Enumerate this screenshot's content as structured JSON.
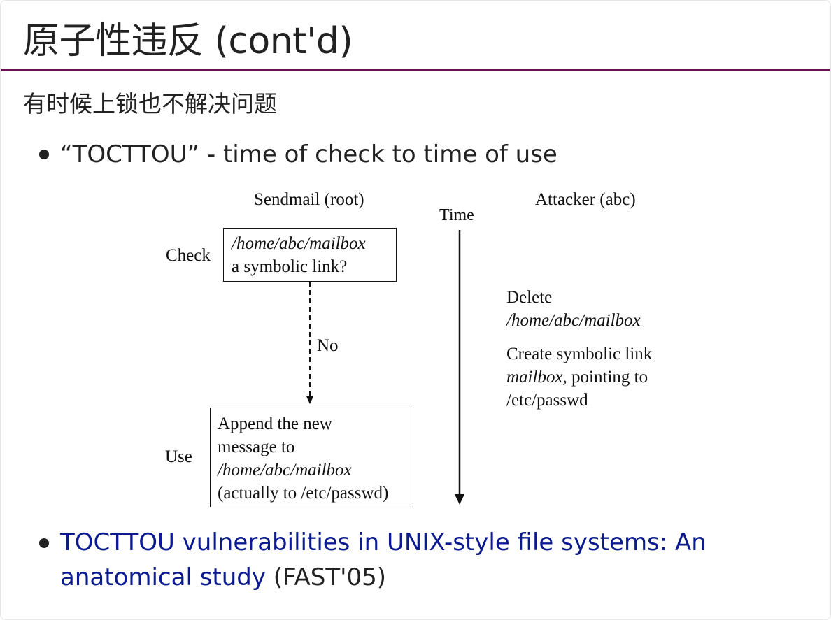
{
  "slide": {
    "title": "原子性违反 (cont'd)",
    "subtitle": "有时候上锁也不解决问题",
    "bullets": [
      {
        "text": "“TOCTTOU” - time of check to time of use"
      },
      {
        "link_text": "TOCTTOU vulnerabilities in UNIX-style file systems: An anatomical study",
        "suffix": " (FAST'05)"
      }
    ]
  },
  "diagram": {
    "left_header": "Sendmail (root)",
    "right_header": "Attacker (abc)",
    "time_label": "Time",
    "check_label": "Check",
    "use_label": "Use",
    "no_label": "No",
    "check_box": {
      "line1": "/home/abc/mailbox",
      "line2": "a symbolic link?"
    },
    "use_box": {
      "line1": "Append the new",
      "line2": "message to",
      "line3": "/home/abc/mailbox",
      "line4": "(actually to /etc/passwd)"
    },
    "attacker": {
      "delete": "Delete",
      "delete_path": "/home/abc/mailbox",
      "create": "Create symbolic link",
      "mailbox": "mailbox",
      "pointing": ", pointing to",
      "target": "/etc/passwd"
    }
  },
  "colors": {
    "rule": "#6b0f5a",
    "link": "#0b1a8e",
    "text": "#222222"
  }
}
